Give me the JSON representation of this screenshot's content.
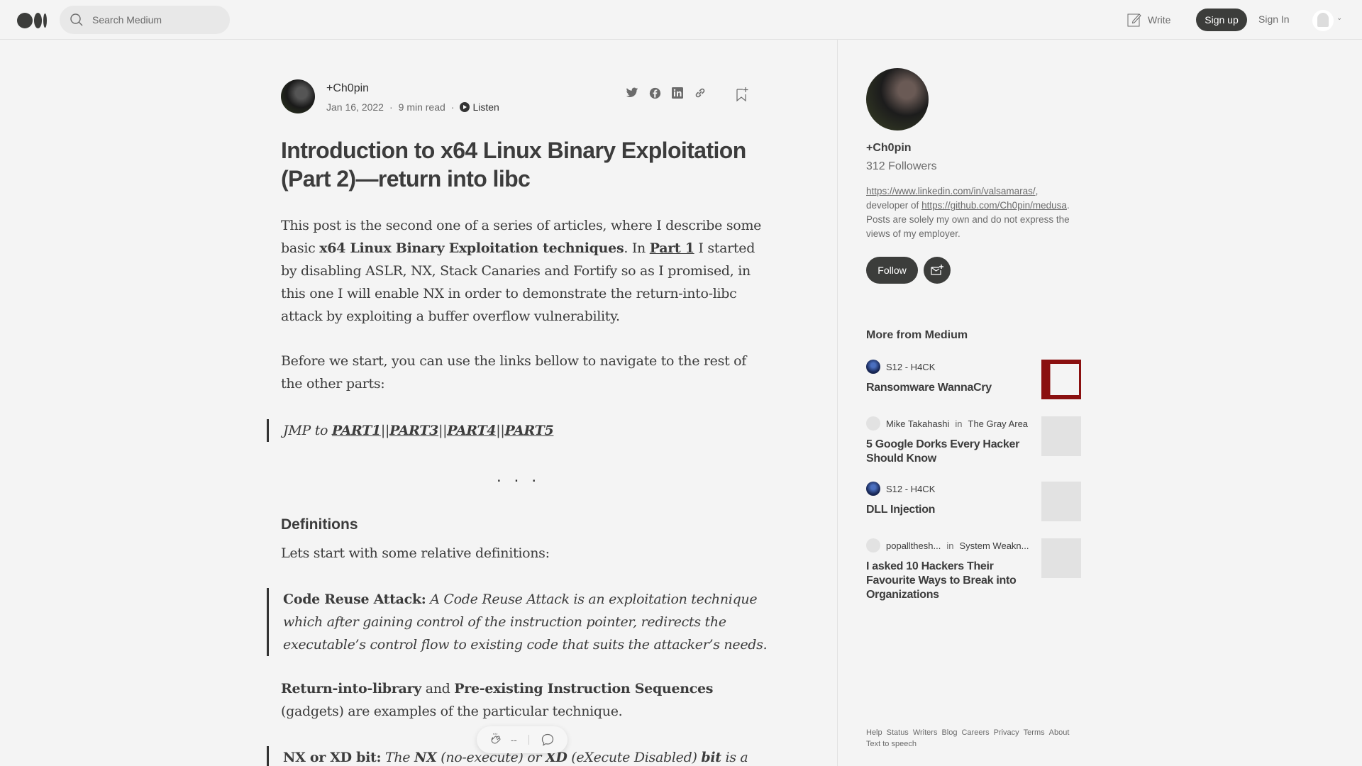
{
  "topbar": {
    "search_placeholder": "Search Medium",
    "write_label": "Write",
    "signup_label": "Sign up",
    "signin_label": "Sign In"
  },
  "article": {
    "author_name": "+Ch0pin",
    "date": "Jan 16, 2022",
    "read_time": "9 min read",
    "listen_label": "Listen",
    "title": "Introduction to x64 Linux Binary Exploitation (Part 2)—return into libc",
    "p1": {
      "t1": "This post is the second one of a series of articles, where I describe some basic ",
      "b1": "x64 Linux Binary Exploitation techniques",
      "t2": ". In ",
      "link": "Part 1",
      "t3": " I started by disabling ASLR, NX, Stack Canaries and Fortify so as I promised, in this one I will enable NX in order to demonstrate the return-into-libc attack by exploiting a buffer overflow vulnerability."
    },
    "p2": "Before we start, you can use the links bellow to navigate to the rest of the other parts:",
    "jmp": {
      "prefix": "JMP to ",
      "links": [
        "PART1",
        "PART3",
        "PART4",
        "PART5"
      ],
      "separator": "||"
    },
    "section_separator": "...",
    "definitions_heading": "Definitions",
    "definitions_intro": "Lets start with some relative definitions:",
    "quote1": {
      "term": "Code Reuse Attack:",
      "text": " A Code Reuse Attack is an exploitation technique which after gaining control of the instruction pointer, redirects the executable’s control flow to existing code that suits the attacker’s needs."
    },
    "p3": {
      "b1": "Return-into-library",
      "t1": " and ",
      "b2": "Pre-existing Instruction Sequences",
      "t2": " (gadgets) are examples of the particular technique."
    },
    "quote2": {
      "term": "NX or XD bit:",
      "t1": " The ",
      "b1": "NX",
      "t2": " (no-execute) or ",
      "b2": "XD",
      "t3": " (eXecute Disabled) ",
      "b3": "bit",
      "t4": " is a"
    },
    "clap_count": "--"
  },
  "sidebar": {
    "author_name": "+Ch0pin",
    "followers": "312 Followers",
    "bio": {
      "link1": "https://www.linkedin.com/in/valsamaras/",
      "t1": ", developer of ",
      "link2": "https://github.com/Ch0pin/medusa",
      "t2": ". Posts are solely my own and do not express the views of my employer."
    },
    "follow_label": "Follow",
    "more_title": "More from Medium",
    "recommendations": [
      {
        "author": "S12 - H4CK",
        "publication": "",
        "title": "Ransomware WannaCry"
      },
      {
        "author": "Mike Takahashi",
        "publication": "The Gray Area",
        "title": "5 Google Dorks Every Hacker Should Know"
      },
      {
        "author": "S12 - H4CK",
        "publication": "",
        "title": "DLL Injection"
      },
      {
        "author": "popallthesh...",
        "publication": "System Weakn...",
        "title": "I asked 10 Hackers Their Favourite Ways to Break into Organizations"
      }
    ],
    "in_label": "in",
    "footer_links": [
      "Help",
      "Status",
      "Writers",
      "Blog",
      "Careers",
      "Privacy",
      "Terms",
      "About",
      "Text to speech"
    ]
  }
}
